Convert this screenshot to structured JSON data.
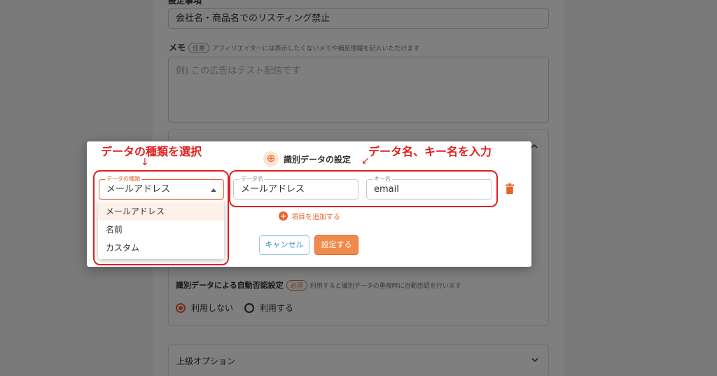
{
  "background": {
    "top_field_label": "設定事項",
    "top_field_value": "会社名・商品名でのリスティング禁止",
    "memo_label": "メモ",
    "memo_chip": "任意",
    "memo_hint": "アフィリエイターには表示したくないメモや補足情報を記入いただけます",
    "memo_placeholder": "例) この広告はテスト配信です",
    "auto_label": "識別データによる自動否認設定",
    "auto_chip": "必須",
    "auto_hint": "利用すると識別データの重複時に自動否認を行います",
    "radio_off": "利用しない",
    "radio_on": "利用する",
    "advanced_label": "上級オプション"
  },
  "dialog": {
    "icon": "⊕",
    "title": "識別データの設定",
    "type_field": {
      "legend": "データの種類",
      "value": "メールアドレス"
    },
    "name_field": {
      "legend": "データ名",
      "value": "メールアドレス"
    },
    "key_field": {
      "legend": "キー名",
      "value": "email"
    },
    "menu_options": [
      "メールアドレス",
      "名前",
      "カスタム"
    ],
    "add_item": "項目を追加する",
    "cancel": "キャンセル",
    "submit": "設定する"
  },
  "annotations": {
    "left_text": "データの種類を選択",
    "left_arrow": "↓",
    "right_text": "データ名、キー名を入力",
    "right_arrow": "↙"
  },
  "colors": {
    "accent": "#e8622d",
    "annotation": "#e02020"
  },
  "icons": {
    "trash": "trash-icon",
    "plus": "plus-circle-icon",
    "chevron": "chevron-down-icon"
  }
}
